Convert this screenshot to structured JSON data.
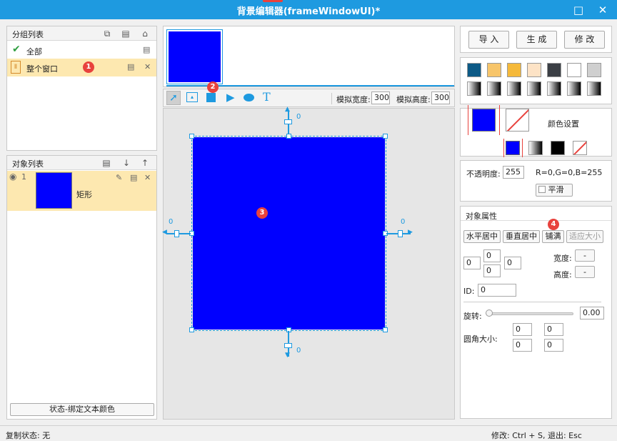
{
  "window": {
    "title": "背景编辑器(frameWindowUI)*"
  },
  "group_list": {
    "header": "分组列表",
    "items": [
      {
        "label": "全部"
      },
      {
        "label": "整个窗口"
      }
    ],
    "state_button": "状态-绑定文本颜色"
  },
  "object_list": {
    "header": "对象列表",
    "items": [
      {
        "index": "1",
        "label": "矩形"
      }
    ]
  },
  "toolbar": {
    "sim_width_label": "模拟宽度:",
    "sim_width_value": "300",
    "sim_height_label": "模拟高度:",
    "sim_height_value": "300"
  },
  "canvas": {
    "top_offset": "0",
    "bottom_offset": "0",
    "left_offset": "0",
    "right_offset": "0",
    "shape_color": "#0000ff"
  },
  "actions": {
    "import": "导 入",
    "generate": "生 成",
    "modify": "修 改"
  },
  "swatches": {
    "row1": [
      "#0d5a86",
      "#f7c56a",
      "#f5b93a",
      "#fde3c6",
      "#3b3f45",
      "#ffffff",
      "#cfcfcf"
    ]
  },
  "color_settings": {
    "label": "颜色设置",
    "current_color": "#0000ff"
  },
  "opacity": {
    "label": "不透明度:",
    "value": "255",
    "rgb_text": "R=0,G=0,B=255",
    "smooth_label": "平滑"
  },
  "object_props": {
    "header": "对象属性",
    "btn_hcenter": "水平居中",
    "btn_vcenter": "垂直居中",
    "btn_fill": "铺满",
    "btn_fit": "适应大小",
    "margin_left": "0",
    "margin_top": "0",
    "margin_bottom": "0",
    "margin_right": "0",
    "width_label": "宽度:",
    "width_value": "-",
    "height_label": "高度:",
    "height_value": "-",
    "id_label": "ID:",
    "id_value": "0",
    "rotate_label": "旋转:",
    "rotate_value": "0.00",
    "corner_label": "圆角大小:",
    "corner_values": [
      "0",
      "0",
      "0",
      "0"
    ]
  },
  "badges": [
    "1",
    "2",
    "3",
    "4"
  ],
  "status": {
    "left": "复制状态:  无",
    "right": "修改: Ctrl + S, 退出: Esc"
  }
}
